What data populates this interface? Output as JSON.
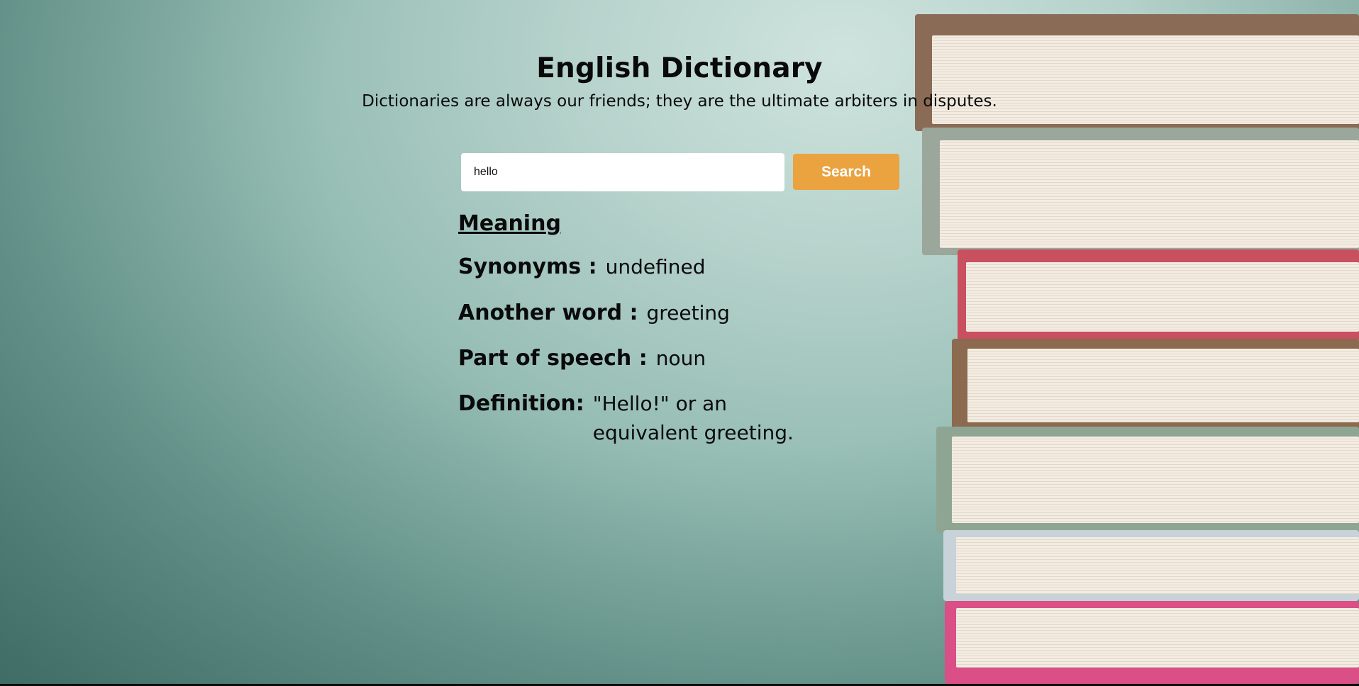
{
  "header": {
    "title": "English Dictionary",
    "subtitle": "Dictionaries are always our friends; they are the ultimate arbiters in disputes."
  },
  "search": {
    "value": "hello",
    "button_label": "Search"
  },
  "result": {
    "heading": "Meaning",
    "synonyms_label": "Synonyms :",
    "synonyms_value": "undefined",
    "another_word_label": "Another word :",
    "another_word_value": "greeting",
    "part_of_speech_label": "Part of speech :",
    "part_of_speech_value": "noun",
    "definition_label": "Definition:",
    "definition_value": "\"Hello!\" or an equivalent greeting."
  },
  "colors": {
    "accent": "#eaa33f",
    "background": "#b7d3cc",
    "text": "#0a0a0a"
  }
}
